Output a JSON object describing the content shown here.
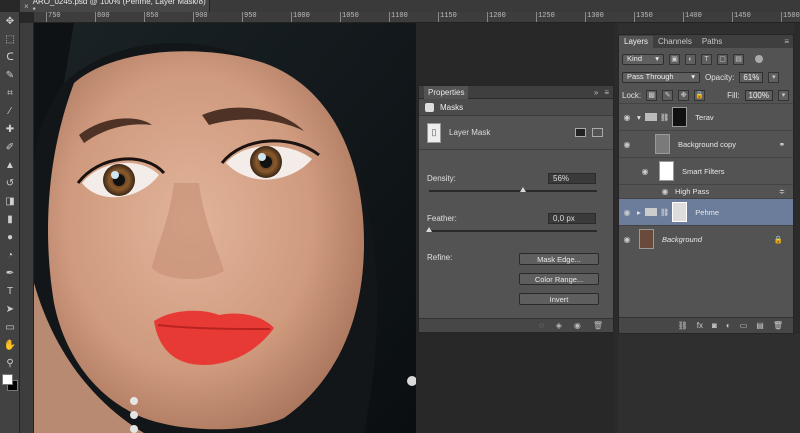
{
  "document": {
    "tab_title": "ARO_0245.psd @ 100% (Pehme, Layer Mask/8) *",
    "close_glyph": "×"
  },
  "ruler": {
    "ticks": [
      "750",
      "800",
      "850",
      "900",
      "950",
      "1000",
      "1050",
      "1100",
      "1150",
      "1200",
      "1250",
      "1300",
      "1350",
      "1400",
      "1450",
      "1500"
    ]
  },
  "tools": [
    "move-icon",
    "marquee-icon",
    "lasso-icon",
    "quick-select-icon",
    "crop-icon",
    "eyedropper-icon",
    "healing-brush-icon",
    "brush-icon",
    "clone-stamp-icon",
    "history-brush-icon",
    "eraser-icon",
    "gradient-icon",
    "blur-icon",
    "dodge-icon",
    "pen-icon",
    "type-icon",
    "path-select-icon",
    "shape-icon",
    "hand-icon",
    "zoom-icon"
  ],
  "properties": {
    "title": "Properties",
    "menu_glyph": "≡",
    "section": "Masks",
    "layer_mask_label": "Layer Mask",
    "density_label": "Density:",
    "density_value": "56%",
    "density": 0.56,
    "feather_label": "Feather:",
    "feather_value": "0,0 px",
    "feather": 0.0,
    "refine_label": "Refine:",
    "mask_edge_button": "Mask Edge...",
    "color_range_button": "Color Range...",
    "invert_button": "Invert"
  },
  "layers_panel": {
    "tabs": [
      "Layers",
      "Channels",
      "Paths"
    ],
    "filter_kind": "Kind",
    "blend_mode": "Pass Through",
    "opacity_label": "Opacity:",
    "opacity_value": "61%",
    "lock_label": "Lock:",
    "fill_label": "Fill:",
    "fill_value": "100%",
    "layers": [
      {
        "name": "Terav",
        "type": "group"
      },
      {
        "name": "Background copy",
        "type": "smart"
      },
      {
        "name": "Smart Filters",
        "type": "filter-mask"
      },
      {
        "name": "High Pass",
        "type": "filter"
      },
      {
        "name": "Pehme",
        "type": "group-selected"
      },
      {
        "name": "Background",
        "type": "background"
      }
    ]
  }
}
